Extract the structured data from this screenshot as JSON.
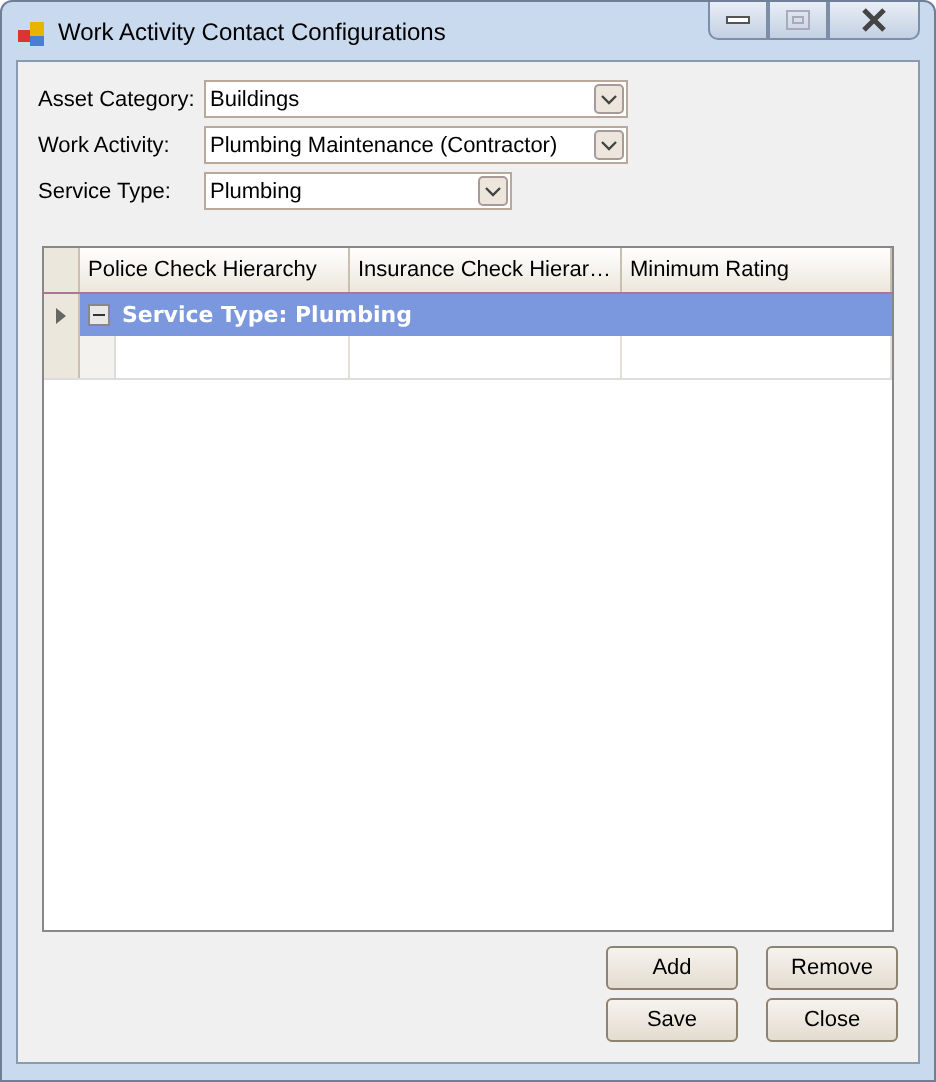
{
  "window": {
    "title": "Work Activity Contact Configurations"
  },
  "filters": [
    {
      "label": "Asset Category:",
      "value": "Buildings"
    },
    {
      "label": "Work Activity:",
      "value": "Plumbing Maintenance (Contractor)"
    },
    {
      "label": "Service Type:",
      "value": "Plumbing"
    }
  ],
  "grid": {
    "columns": [
      "Police Check Hierarchy",
      "Insurance Check Hierar…",
      "Minimum Rating"
    ],
    "group_row": {
      "text": "Service Type: Plumbing",
      "expanded": true,
      "current": true
    },
    "new_row": {
      "current": false
    }
  },
  "buttons": [
    [
      "Add",
      "Remove"
    ],
    [
      "Save",
      "Close"
    ]
  ]
}
